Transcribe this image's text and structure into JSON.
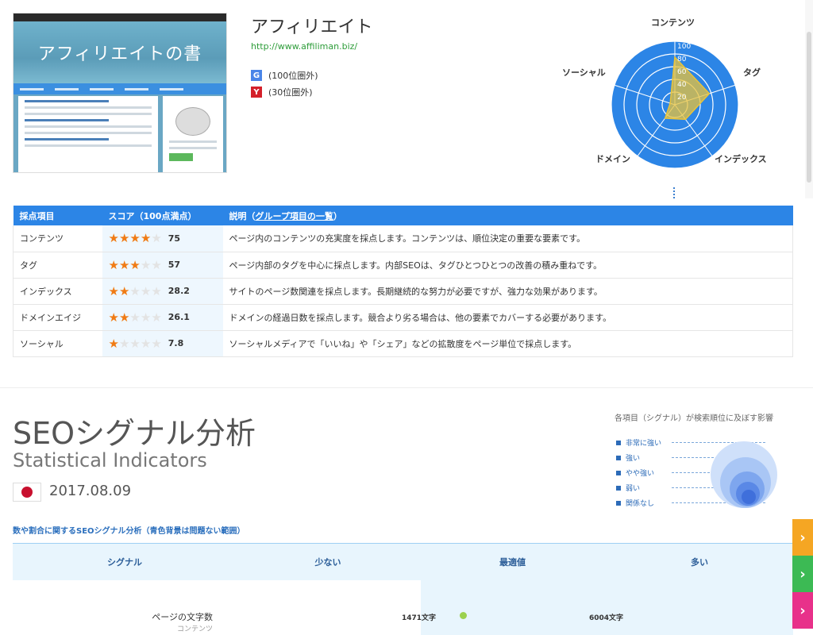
{
  "site": {
    "thumbnail_title": "アフィリエイトの書",
    "title": "アフィリエイト",
    "url": "http://www.affiliman.biz/",
    "rankings": [
      {
        "engine": "G",
        "text": "(100位圏外)",
        "color": "#4a85e8"
      },
      {
        "engine": "Y",
        "text": "(30位圏外)",
        "color": "#d4202a"
      }
    ]
  },
  "chart_data": {
    "type": "radar",
    "axes": [
      "コンテンツ",
      "タグ",
      "インデックス",
      "ドメイン",
      "ソーシャル"
    ],
    "values": [
      75,
      57,
      28.2,
      26.1,
      7.8
    ],
    "range": [
      0,
      100
    ],
    "ticks": [
      "20",
      "40",
      "60",
      "80",
      "100"
    ],
    "colors": {
      "background": "#2c85e6",
      "series": "#e9c33a"
    }
  },
  "score_table": {
    "headers": [
      "採点項目",
      "スコア（100点満点）",
      "説明（",
      "グループ項目の一覧",
      "）"
    ],
    "rows": [
      {
        "name": "コンテンツ",
        "stars": 4,
        "score": "75",
        "desc": "ページ内のコンテンツの充実度を採点します。コンテンツは、順位決定の重要な要素です。"
      },
      {
        "name": "タグ",
        "stars": 3,
        "score": "57",
        "desc": "ページ内部のタグを中心に採点します。内部SEOは、タグひとつひとつの改善の積み重ねです。"
      },
      {
        "name": "インデックス",
        "stars": 2,
        "score": "28.2",
        "desc": "サイトのページ数関連を採点します。長期継続的な努力が必要ですが、強力な効果があります。"
      },
      {
        "name": "ドメインエイジ",
        "stars": 2,
        "score": "26.1",
        "desc": "ドメインの経過日数を採点します。競合より劣る場合は、他の要素でカバーする必要があります。"
      },
      {
        "name": "ソーシャル",
        "stars": 1,
        "score": "7.8",
        "desc": "ソーシャルメディアで「いいね」や「シェア」などの拡散度をページ単位で採点します。"
      }
    ]
  },
  "seo": {
    "title": "SEOシグナル分析",
    "subtitle": "Statistical Indicators",
    "date": "2017.08.09",
    "legend_title": "各項目（シグナル）が検索順位に及ぼす影響",
    "legend": [
      "非常に強い",
      "強い",
      "やや強い",
      "弱い",
      "関係なし"
    ],
    "section_title": "数や割合に関するSEOシグナル分析（青色背景は問題ない範囲）",
    "columns": [
      "シグナル",
      "少ない",
      "最適値",
      "多い"
    ],
    "row": {
      "name": "ページの文字数",
      "category": "コンテンツ",
      "low": "1471文字",
      "high": "6004文字"
    }
  },
  "side_tabs": [
    {
      "icon": "chevron-right-icon",
      "color": "#f5a623"
    },
    {
      "icon": "chevron-right-icon",
      "color": "#3cba54"
    },
    {
      "icon": "chevron-right-icon",
      "color": "#e8318a"
    }
  ]
}
